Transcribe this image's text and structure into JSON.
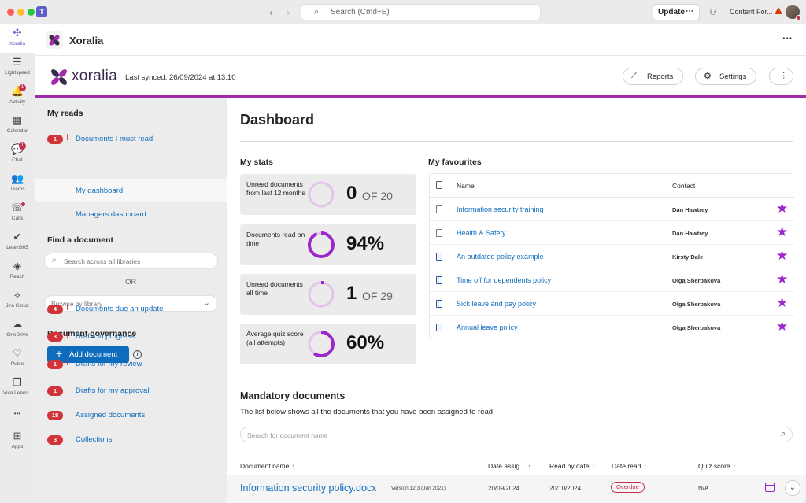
{
  "titlebar": {
    "search_placeholder": "Search (Cmd+E)",
    "update_label": "Update",
    "update_more": "⋯",
    "content_for": "Content For...",
    "teams_logo": "T",
    "back_arrow": "‹",
    "forward_arrow": "›"
  },
  "rail": {
    "items": [
      {
        "label": "Xoralia",
        "icon": "xoralia-icon",
        "glyph": "✣"
      },
      {
        "label": "Lightspeed",
        "icon": "lightspeed-icon",
        "glyph": "☰"
      },
      {
        "label": "Activity",
        "icon": "bell-icon",
        "glyph": "🔔",
        "badge": "1"
      },
      {
        "label": "Calendar",
        "icon": "calendar-icon",
        "glyph": "▦"
      },
      {
        "label": "Chat",
        "icon": "chat-icon",
        "glyph": "💬",
        "badge": "1"
      },
      {
        "label": "Teams",
        "icon": "teams-icon",
        "glyph": "👥"
      },
      {
        "label": "Calls",
        "icon": "phone-icon",
        "glyph": "☏"
      },
      {
        "label": "Learn365",
        "icon": "learn365-icon",
        "glyph": "✔"
      },
      {
        "label": "Reach",
        "icon": "reach-icon",
        "glyph": "◈"
      },
      {
        "label": "Jira Cloud",
        "icon": "jira-icon",
        "glyph": "⟡"
      },
      {
        "label": "OneDrive",
        "icon": "cloud-icon",
        "glyph": "☁"
      },
      {
        "label": "Pulse",
        "icon": "heart-pulse-icon",
        "glyph": "♡"
      },
      {
        "label": "Viva Learn...",
        "icon": "viva-learning-icon",
        "glyph": "❐"
      },
      {
        "label": "",
        "icon": "more-icon",
        "glyph": "•••"
      },
      {
        "label": "Apps",
        "icon": "apps-icon",
        "glyph": "⊞"
      }
    ]
  },
  "app_header": {
    "title": "Xoralia",
    "more": "···"
  },
  "xor_header": {
    "brand": "xoralia",
    "last_synced": "Last synced: 26/09/2024 at 13:10",
    "reports_label": "Reports",
    "settings_label": "Settings",
    "more": "⋮"
  },
  "leftnav": {
    "my_reads": "My reads",
    "must_read": {
      "badge": "1",
      "label": "Documents I must read"
    },
    "my_dashboard": "My dashboard",
    "managers_dashboard": "Managers dashboard",
    "find_document": "Find a document",
    "search_placeholder": "Search across all libraries",
    "or": "OR",
    "browse_placeholder": "Browse by library",
    "governance": "Document governance",
    "add_document": "Add document",
    "items": [
      {
        "badge": "4",
        "excl": true,
        "label": "Documents due an update"
      },
      {
        "badge": "3",
        "excl": true,
        "label": "Drafts in progress"
      },
      {
        "badge": "1",
        "excl": true,
        "label": "Drafts for my review"
      },
      {
        "badge": "1",
        "excl": false,
        "label": "Drafts for my approval"
      },
      {
        "badge": "18",
        "excl": false,
        "label": "Assigned documents"
      },
      {
        "badge": "3",
        "excl": false,
        "label": "Collections"
      }
    ]
  },
  "dashboard": {
    "title": "Dashboard",
    "my_stats": "My stats",
    "stats": [
      {
        "label": "Unread documents from last 12 months",
        "value": "0",
        "of": "OF 20",
        "fraction": 0
      },
      {
        "label": "Documents read on time",
        "value": "94%",
        "of": "",
        "fraction": 0.94
      },
      {
        "label": "Unread documents all time",
        "value": "1",
        "of": "OF 29",
        "fraction": 0.035
      },
      {
        "label": "Average quiz score (all attempts)",
        "value": "60%",
        "of": "",
        "fraction": 0.6
      }
    ],
    "my_favourites": "My favourites",
    "fav_headers": {
      "name": "Name",
      "contact": "Contact"
    },
    "favourites": [
      {
        "name": "Information security training",
        "contact": "Dan Hawtrey",
        "type": "page"
      },
      {
        "name": "Health & Safety",
        "contact": "Dan Hawtrey",
        "type": "page"
      },
      {
        "name": "An outdated policy example",
        "contact": "Kirsty Dale",
        "type": "word"
      },
      {
        "name": "Time off for dependents policy",
        "contact": "Olga Sherbakova",
        "type": "word"
      },
      {
        "name": "Sick leave and pay policy",
        "contact": "Olga Sherbakova",
        "type": "word"
      },
      {
        "name": "Annual leave policy",
        "contact": "Olga Sherbakova",
        "type": "word"
      }
    ],
    "mandatory_title": "Mandatory documents",
    "mandatory_desc": "The list below shows all the documents that you have been assigned to read.",
    "mandatory_search_placeholder": "Search for document name",
    "columns": {
      "name": "Document name",
      "assigned": "Date assig...",
      "read_by": "Read by date",
      "date_read": "Date read",
      "quiz": "Quiz score"
    },
    "rows": [
      {
        "name": "Information security policy.docx",
        "version": "Version 12.3 (Jun 2021)",
        "assigned": "20/09/2024",
        "read_by": "20/10/2024",
        "status": "Overdue",
        "quiz": "N/A"
      }
    ]
  }
}
